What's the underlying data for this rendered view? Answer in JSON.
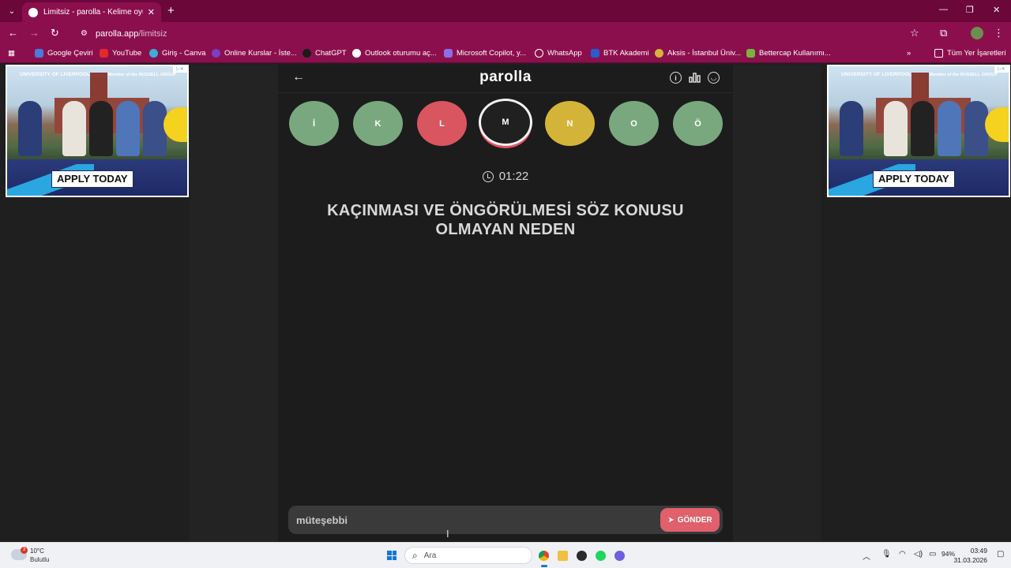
{
  "browser": {
    "tab_title": "Limitsiz - parolla - Kelime oyunu",
    "tab_close": "✕",
    "new_tab": "+",
    "url_domain": "parolla.app",
    "url_path": "/limitsiz",
    "window_minimize": "—",
    "window_restore": "❐",
    "window_close": "✕",
    "back": "←",
    "forward": "→",
    "reload": "↻",
    "star": "☆",
    "extensions": "⧉",
    "menu": "⋮",
    "bookmarks": [
      {
        "label": "Google Çeviri",
        "color": "#4a7bd9"
      },
      {
        "label": "YouTube",
        "color": "#e02b2b"
      },
      {
        "label": "Giriş - Canva",
        "color": "#3ab0d6"
      },
      {
        "label": "Online Kurslar - İste...",
        "color": "#7a3fc4"
      },
      {
        "label": "ChatGPT",
        "color": "#1b1b1b"
      },
      {
        "label": "Outlook oturumu aç...",
        "color": "#ffffff"
      },
      {
        "label": "Microsoft Copilot, y...",
        "color": "#8c6ee6"
      },
      {
        "label": "WhatsApp",
        "color": "#ffffff"
      },
      {
        "label": "BTK Akademi",
        "color": "#2a5bd0"
      },
      {
        "label": "Aksis - İstanbul Üniv...",
        "color": "#d8b13a"
      },
      {
        "label": "Bettercap Kullanımı...",
        "color": "#7ab33b"
      }
    ],
    "bookmarks_more": "»",
    "all_bookmarks": "Tüm Yer İşaretleri"
  },
  "ads": {
    "left": {
      "cta": "APPLY TODAY",
      "logo_left": "UNIVERSITY OF LIVERPOOL",
      "logo_right": "Member of the RUSSELL GROUP"
    },
    "right": {
      "cta": "APPLY TODAY",
      "logo_left": "UNIVERSITY OF LIVERPOOL",
      "logo_right": "Member of the RUSSELL GROUP"
    }
  },
  "game": {
    "brand": "parolla",
    "back_icon": "←",
    "letters": [
      {
        "char": "İ",
        "state": "correct",
        "color": "#7aa87e"
      },
      {
        "char": "K",
        "state": "correct",
        "color": "#7aa87e"
      },
      {
        "char": "L",
        "state": "wrong",
        "color": "#d9555f"
      },
      {
        "char": "M",
        "state": "current",
        "color": "#202020"
      },
      {
        "char": "N",
        "state": "passed",
        "color": "#d4b438"
      },
      {
        "char": "O",
        "state": "correct",
        "color": "#7aa87e"
      },
      {
        "char": "Ö",
        "state": "correct",
        "color": "#7aa87e"
      }
    ],
    "timer": "01:22",
    "question": "KAÇINMASI VE ÖNGÖRÜLMESİ SÖZ KONUSU OLMAYAN NEDEN",
    "answer_value": "müteşebbi",
    "send_label": "GÖNDER",
    "send_icon": "➤"
  },
  "taskbar": {
    "temperature": "10°C",
    "condition": "Bulutlu",
    "weather_badge": "3",
    "search_placeholder": "Ara",
    "battery": "94%",
    "time": "03:49",
    "date": "31.03.2026",
    "tray_chevron": "︿"
  },
  "colors": {
    "browser_frame": "#8c0f4d",
    "game_bg": "#1c1c1c",
    "send_button": "#e0606b"
  }
}
